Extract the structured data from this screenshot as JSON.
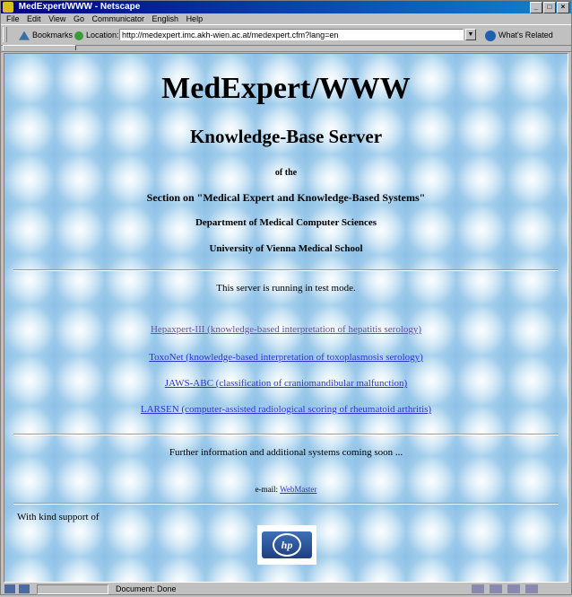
{
  "window": {
    "title": "MedExpert/WWW - Netscape"
  },
  "menu": [
    "File",
    "Edit",
    "View",
    "Go",
    "Communicator",
    "English",
    "Help"
  ],
  "toolbar": {
    "bookmarks_label": "Bookmarks",
    "location_label": "Location:",
    "url": "http://medexpert.imc.akh-wien.ac.at/medexpert.cfm?lang=en",
    "whats_related": "What's Related"
  },
  "page": {
    "title": "MedExpert/WWW",
    "subtitle": "Knowledge-Base Server",
    "of_the": "of the",
    "section": "Section on \"Medical Expert and Knowledge-Based Systems\"",
    "department": "Department of Medical Computer Sciences",
    "university": "University of Vienna Medical School",
    "test_mode": "This server is running in test mode.",
    "links": [
      {
        "text": "Hepaxpert-III (knowledge-based interpretation of hepatitis serology)",
        "visited": true
      },
      {
        "text": "ToxoNet (knowledge-based interpretation of toxoplasmosis serology)",
        "visited": false
      },
      {
        "text": "JAWS-ABC (classification of craniomandibular malfunction)",
        "visited": false
      },
      {
        "text": "LARSEN (computer-assisted radiological scoring of rheumatoid arthritis)",
        "visited": false
      }
    ],
    "further": "Further information and additional systems coming soon ...",
    "email_label": "e-mail:",
    "email_link": "WebMaster",
    "support": "With kind support of",
    "logo_text": "hp"
  },
  "status": {
    "text": "Document: Done"
  },
  "icons": [
    "netscape-icon",
    "bookmarks-icon",
    "location-icon",
    "whats-related-icon",
    "hp-logo",
    "security-icon",
    "mail-icon",
    "composer-icon"
  ]
}
